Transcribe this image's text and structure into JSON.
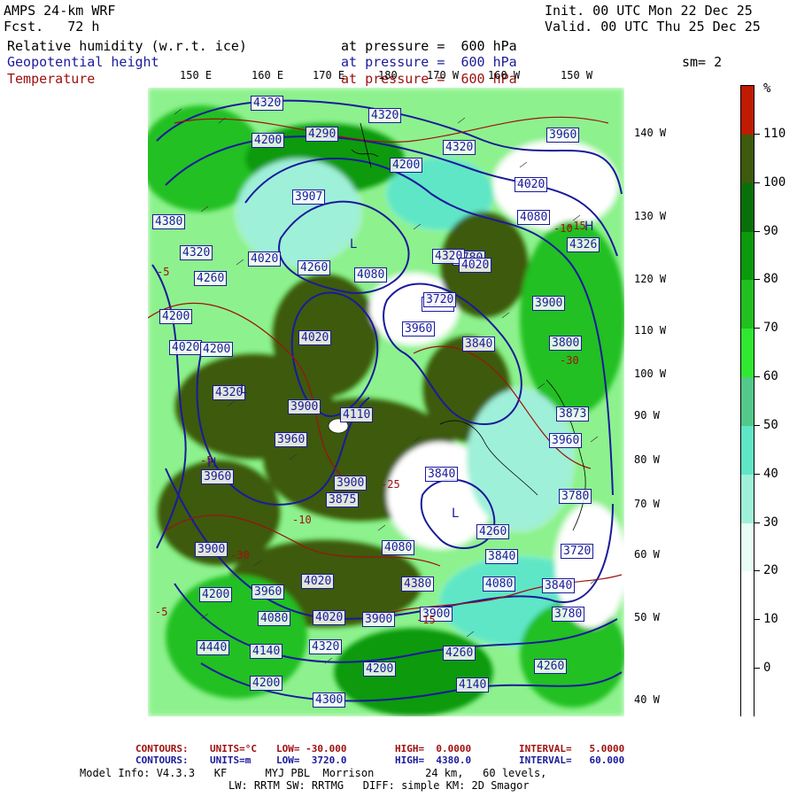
{
  "header": {
    "model": "AMPS 24-km WRF",
    "fcst": "Fcst.   72 h",
    "init": "Init. 00 UTC Mon 22 Dec 25",
    "valid": "Valid. 00 UTC Thu 25 Dec 25",
    "smooth": "sm= 2"
  },
  "fields": [
    {
      "name": "Relative humidity (w.r.t. ice)",
      "level": "at pressure =  600 hPa",
      "color": "#000000"
    },
    {
      "name": "Geopotential height",
      "level": "at pressure =  600 hPa",
      "color": "#1a1a9c"
    },
    {
      "name": "Temperature",
      "level": "at pressure =  600 hPa",
      "color": "#a01010"
    }
  ],
  "lon_labels": [
    "150 E",
    "160 E",
    "170 E",
    "180",
    "170 W",
    "160 W",
    "150 W"
  ],
  "lat_side_labels": [
    "140 W",
    "130 W",
    "120 W",
    "110 W",
    "100 W",
    "90 W",
    "80 W",
    "70 W",
    "60 W",
    "50 W",
    "40 W"
  ],
  "colorbar": {
    "unit": "%",
    "ticks": [
      "110",
      "100",
      "90",
      "80",
      "70",
      "60",
      "50",
      "40",
      "30",
      "20",
      "10",
      "0"
    ],
    "colors": [
      "#ffffff",
      "#ffffff",
      "#ffffff",
      "#e8fdf5",
      "#9ff0d8",
      "#5fe6c6",
      "#52c98a",
      "#2fe82f",
      "#20c020",
      "#0a9a0a",
      "#087008",
      "#3e5a0c",
      "#c01a00"
    ]
  },
  "map": {
    "height_contours": [
      "4320",
      "4320",
      "4290",
      "4200",
      "4320",
      "4200",
      "4380",
      "4320",
      "4260",
      "4200",
      "4020",
      "4020",
      "4260",
      "4020",
      "4200",
      "3900",
      "4110",
      "3960",
      "3900",
      "3840",
      "3960",
      "3840",
      "3720",
      "3780",
      "3900",
      "3873",
      "3960",
      "3780",
      "3720",
      "3840",
      "4080",
      "3840",
      "3780",
      "3900",
      "3900",
      "4020",
      "3960",
      "4080",
      "4020",
      "4080",
      "4200",
      "4260",
      "4320",
      "4140",
      "4140",
      "4260",
      "4300",
      "4200",
      "4200",
      "4440",
      "4380",
      "4320",
      "4260",
      "4320",
      "3960",
      "4080",
      "4020",
      "4080",
      "3720",
      "4020",
      "3960",
      "3907",
      "4326",
      "3800",
      "3900",
      "3875"
    ],
    "temperature_labels": [
      "-5",
      "-5",
      "-10",
      "-5",
      "-15",
      "-30",
      "-30",
      "-25",
      "-15",
      "-10"
    ],
    "hl_labels": [
      "H",
      "L",
      "L",
      "H",
      "L"
    ],
    "lon_line_label": "180"
  },
  "footer": {
    "t_line": {
      "label": "CONTOURS:",
      "units": "UNITS=°C",
      "low": "LOW= -30.000",
      "high": "HIGH=  0.0000",
      "interval": "INTERVAL=   5.0000"
    },
    "z_line": {
      "label": "CONTOURS:",
      "units": "UNITS=m",
      "low": "LOW=  3720.0",
      "high": "HIGH=  4380.0",
      "interval": "INTERVAL=   60.000"
    },
    "model_info": "Model Info: V4.3.3   KF      MYJ PBL  Morrison        24 km,   60 levels,",
    "model_info2": "LW: RRTM SW: RRTMG   DIFF: simple KM: 2D Smagor"
  }
}
